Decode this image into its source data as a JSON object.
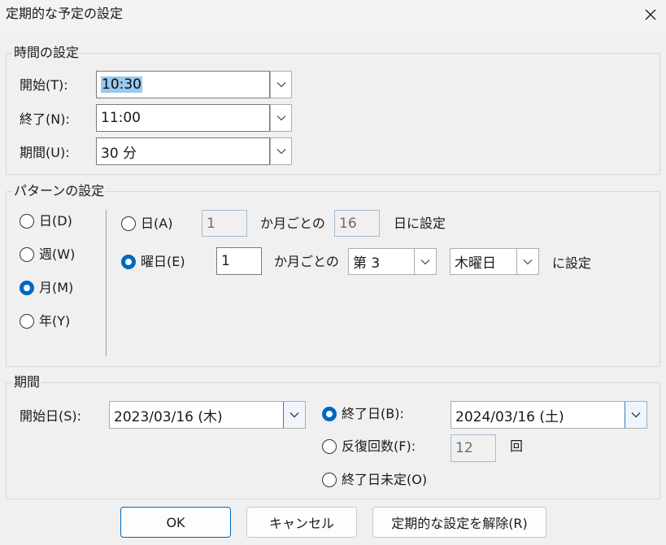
{
  "window": {
    "title": "定期的な予定の設定"
  },
  "time_group": {
    "label": "時間の設定",
    "start": {
      "label": "開始(T):",
      "value": "10:30"
    },
    "end": {
      "label": "終了(N):",
      "value": "11:00"
    },
    "duration": {
      "label": "期間(U):",
      "value": "30 分"
    }
  },
  "pattern_group": {
    "label": "パターンの設定",
    "frequency": [
      {
        "label": "日(D)",
        "checked": false
      },
      {
        "label": "週(W)",
        "checked": false
      },
      {
        "label": "月(M)",
        "checked": true
      },
      {
        "label": "年(Y)",
        "checked": false
      }
    ],
    "day_option": {
      "label": "日(A)",
      "every_months": "1",
      "months_text": "か月ごとの",
      "day": "16",
      "suffix": "日に設定"
    },
    "weekday_option": {
      "label": "曜日(E)",
      "every_months": "1",
      "months_text": "か月ごとの",
      "ordinal": "第 3",
      "weekday": "木曜日",
      "suffix": "に設定"
    }
  },
  "range_group": {
    "label": "期間",
    "start_label": "開始日(S):",
    "start_value": "2023/03/16 (木)",
    "end_by": {
      "label": "終了日(B):",
      "value": "2024/03/16 (土)"
    },
    "end_after": {
      "label": "反復回数(F):",
      "value": "12",
      "unit": "回"
    },
    "no_end": {
      "label": "終了日未定(O)"
    }
  },
  "buttons": {
    "ok": "OK",
    "cancel": "キャンセル",
    "remove": "定期的な設定を解除(R)"
  }
}
